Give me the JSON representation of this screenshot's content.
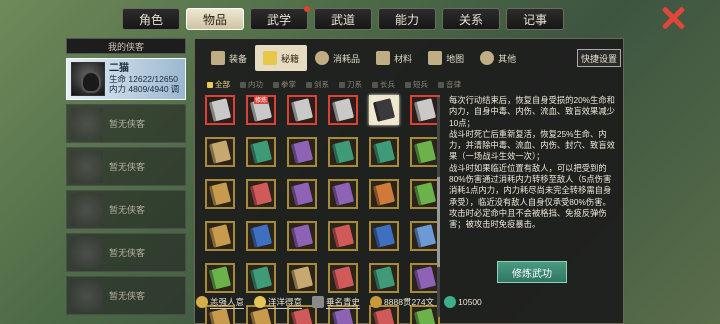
{
  "tabs": [
    "角色",
    "物品",
    "武学",
    "武道",
    "能力",
    "关系",
    "记事"
  ],
  "left": {
    "title": "我的侠客",
    "char": {
      "name": "二猫",
      "hp_label": "生命",
      "hp": "12622/12650",
      "mp_label": "内力",
      "mp": "4809/4940",
      "tag": "调"
    },
    "empty": [
      "暂无侠客",
      "暂无侠客",
      "暂无侠客",
      "暂无侠客",
      "暂无侠客",
      "暂无侠客"
    ]
  },
  "categories": [
    {
      "label": "装备",
      "icon": "armor-icon",
      "color": "#bfae83"
    },
    {
      "label": "秘籍",
      "icon": "book-icon",
      "color": "#e6c84a"
    },
    {
      "label": "消耗品",
      "icon": "potion-icon",
      "color": "#bfae83"
    },
    {
      "label": "材料",
      "icon": "material-icon",
      "color": "#bfae83"
    },
    {
      "label": "地图",
      "icon": "map-icon",
      "color": "#bfae83"
    },
    {
      "label": "其他",
      "icon": "other-icon",
      "color": "#bfae83"
    }
  ],
  "quick": "快捷设置",
  "filters": [
    "全部",
    "内功",
    "拳掌",
    "剑系",
    "刀系",
    "长兵",
    "短兵",
    "音律"
  ],
  "badge": "修炼",
  "desc": [
    "每次行动结束后，恢复自身受损的20%生命和内力，自身中毒、内伤、流血、致盲效果减少10点；",
    "战斗时死亡后重新复活，恢复25%生命、内力，并清除中毒、流血、内伤、封穴、致盲效果（一场战斗生效一次）；",
    "战斗时如果临近位置有敌人，可以把受到的80%伤害通过消耗内力转移至敌人（5点伤害消耗1点内力，内力耗尽尚未完全转移需自身承受），临近没有敌人自身仅承受80%伤害。",
    "攻击时必定命中且不会被格挡、免疫反弹伤害；被攻击时免疫暴击。"
  ],
  "train": "修炼武功",
  "bottom": [
    "恙强人意",
    "洋洋得意",
    "垂名青史",
    "8888贯274文",
    "10500"
  ],
  "book_colors": [
    "#c9c9c9",
    "#c9c9c9",
    "#c9c9c9",
    "#c9c9c9",
    "#3a3a3a",
    "#c9c9c9",
    "#c7a86e",
    "#3f9a78",
    "#8e63b6",
    "#3f9a78",
    "#3f9a78",
    "#6bb24a",
    "#c79a4e",
    "#d05a5a",
    "#8e63b6",
    "#8e63b6",
    "#d07a3a",
    "#6bb24a",
    "#c79a4e",
    "#3f6fc0",
    "#8e63b6",
    "#d05a5a",
    "#3f6fc0",
    "#6b9ad6",
    "#6bb24a",
    "#3f9a78",
    "#c7a86e",
    "#d05a5a",
    "#3f9a78",
    "#8e63b6",
    "#c79a4e",
    "#c79a4e",
    "#d05a5a",
    "#8e63b6",
    "#d05a5a",
    "#6bb24a"
  ]
}
